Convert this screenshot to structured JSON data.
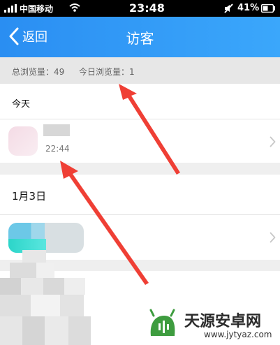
{
  "status_bar": {
    "carrier": "中国移动",
    "time": "23:48",
    "battery": "41%",
    "icons": [
      "signal-icon",
      "wifi-icon",
      "mute-icon",
      "battery-icon"
    ]
  },
  "nav": {
    "back_label": "返回",
    "title": "访客",
    "back_icon": "chevron-left-icon",
    "accent": "#2f98f7"
  },
  "stats": {
    "total": "总浏览量：49",
    "today": "今日浏览量：1"
  },
  "sections": {
    "today": {
      "label": "今天",
      "visitor": {
        "time": "22:44",
        "chevron_icon": "chevron-right-icon"
      }
    },
    "date": {
      "label": "1月3日",
      "visitor": {
        "chevron_icon": "chevron-right-icon"
      }
    }
  },
  "annotation": {
    "color": "#ef3f35"
  },
  "watermark": {
    "name": "天源安卓网",
    "url": "www.jytyaz.com"
  }
}
